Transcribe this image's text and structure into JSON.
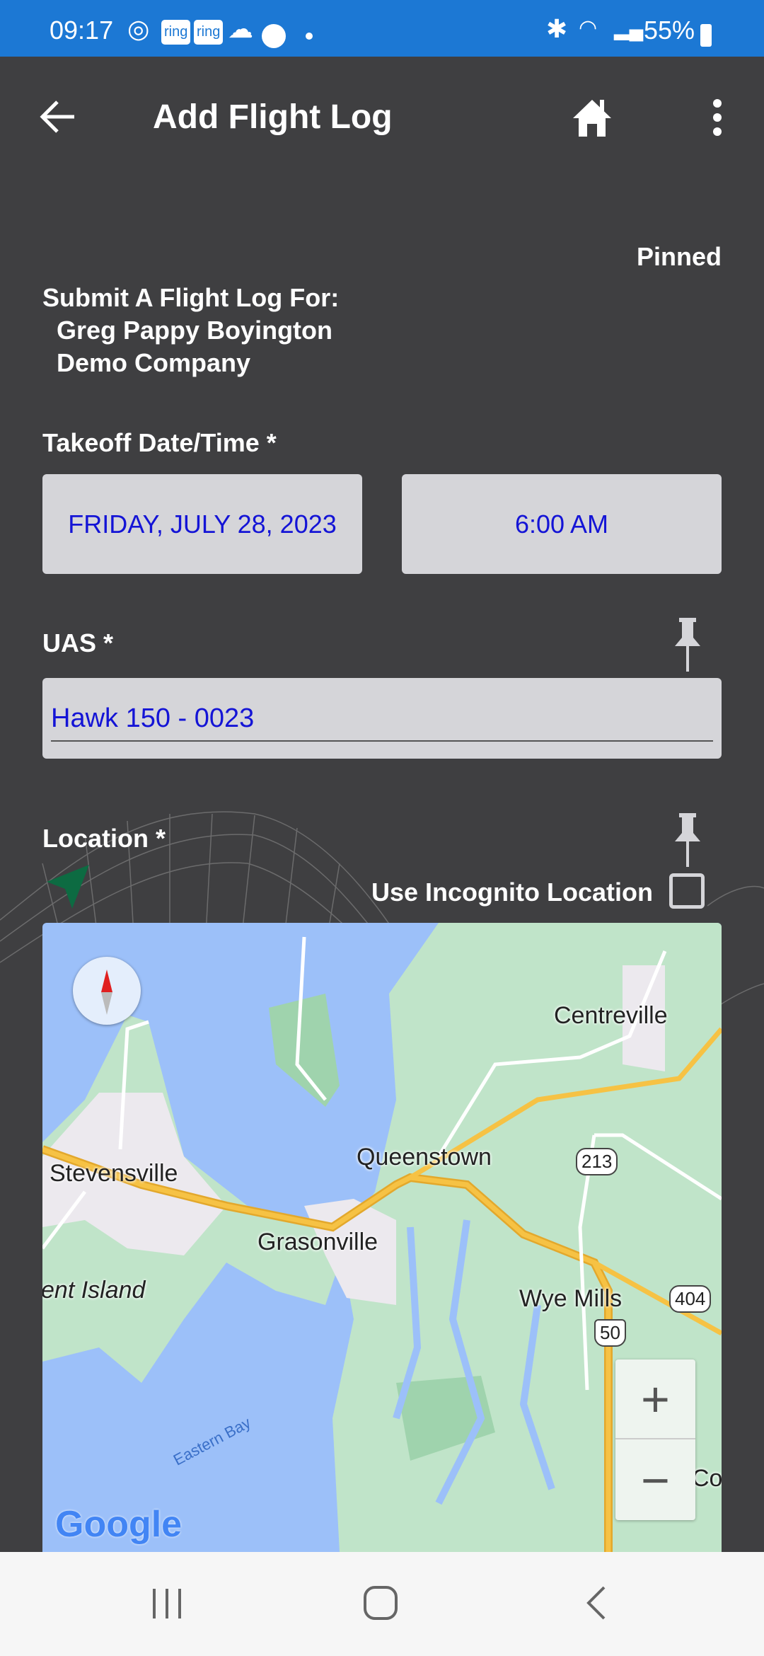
{
  "status_bar": {
    "time": "09:17",
    "notif_icons": [
      "find-my-icon",
      "ring",
      "ring",
      "cloud-icon",
      "account-icon",
      "dot"
    ],
    "battery": "55%"
  },
  "app_bar": {
    "title": "Add Flight Log"
  },
  "form": {
    "pinned_label": "Pinned",
    "submit_for_label": "Submit A Flight Log For:",
    "pilot_name": "Greg Pappy Boyington",
    "company": "Demo Company",
    "takeoff_label": "Takeoff Date/Time *",
    "takeoff_date": "FRIDAY, JULY 28, 2023",
    "takeoff_time": "6:00 AM",
    "uas_label": "UAS *",
    "uas_value": "Hawk 150 - 0023",
    "location_label": "Location *",
    "incognito_label": "Use Incognito Location",
    "incognito_checked": false
  },
  "map": {
    "places": [
      "Centreville",
      "Stevensville",
      "Queenstown",
      "Grasonville",
      "ent Island",
      "Wye Mills",
      "Co"
    ],
    "water_label": "Eastern Bay",
    "shields": [
      "213",
      "404",
      "50"
    ],
    "zoom_in": "+",
    "zoom_out": "−",
    "logo": "Google",
    "colors": {
      "water": "#9cc0f9",
      "land": "#c0e4c9",
      "urban": "#ece9ee",
      "highway": "#f6c244"
    }
  },
  "colors": {
    "status_bar": "#1c78d4",
    "background": "#3f3f41",
    "field_text": "#1414d6",
    "field_bg": "#d5d5d9"
  }
}
